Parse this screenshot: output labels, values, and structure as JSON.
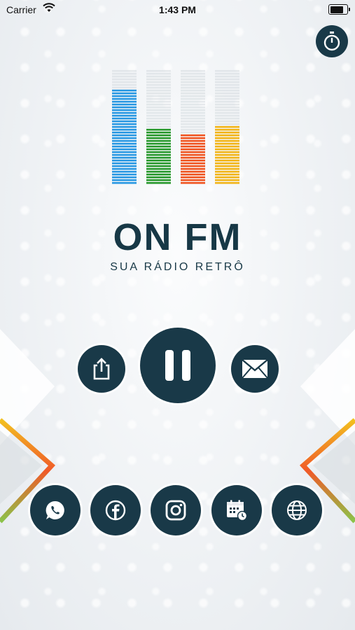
{
  "status_bar": {
    "carrier": "Carrier",
    "time": "1:43 PM",
    "battery_level": 0.9
  },
  "brand": {
    "title": "ON FM",
    "subtitle": "SUA RÁDIO RETRÔ"
  },
  "equalizer": {
    "bars": [
      {
        "color": "#2f9be3",
        "level": 0.85
      },
      {
        "color": "#2e9b33",
        "level": 0.5
      },
      {
        "color": "#f05a28",
        "level": 0.46
      },
      {
        "color": "#f2b720",
        "level": 0.53
      }
    ]
  },
  "player": {
    "share_icon": "share-icon",
    "pause_icon": "pause-icon",
    "mail_icon": "mail-icon",
    "timer_icon": "stopwatch-icon"
  },
  "social": [
    "whatsapp-icon",
    "facebook-icon",
    "instagram-icon",
    "calendar-icon",
    "globe-icon"
  ],
  "colors": {
    "button": "#193948",
    "text": "#173846"
  }
}
